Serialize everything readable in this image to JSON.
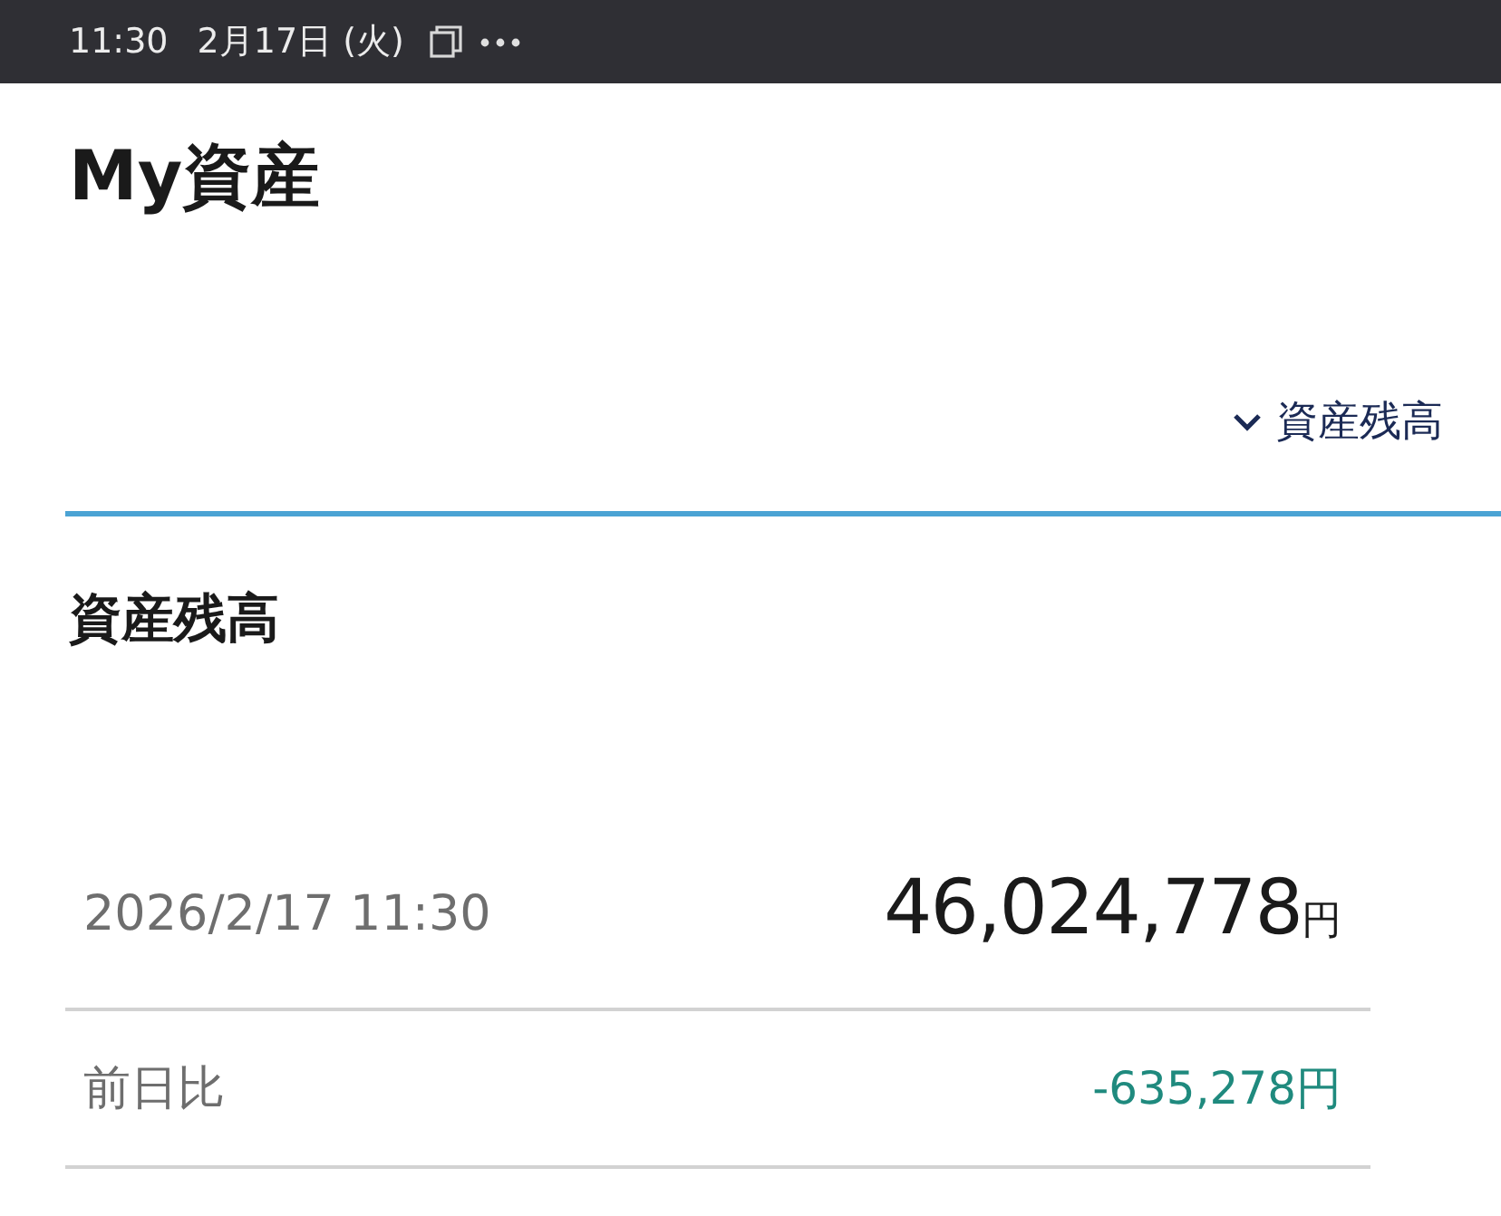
{
  "status_bar": {
    "time": "11:30",
    "date": "2月17日 (火)"
  },
  "page": {
    "title": "My資産"
  },
  "section_selector": {
    "label": "資産残高"
  },
  "section": {
    "title": "資産残高",
    "rows": [
      {
        "kind": "total",
        "label": "2026/2/17 11:30",
        "value": "46,024,778",
        "unit": "円"
      },
      {
        "kind": "change",
        "label": "前日比",
        "value": "-635,278",
        "unit": "円"
      }
    ]
  }
}
